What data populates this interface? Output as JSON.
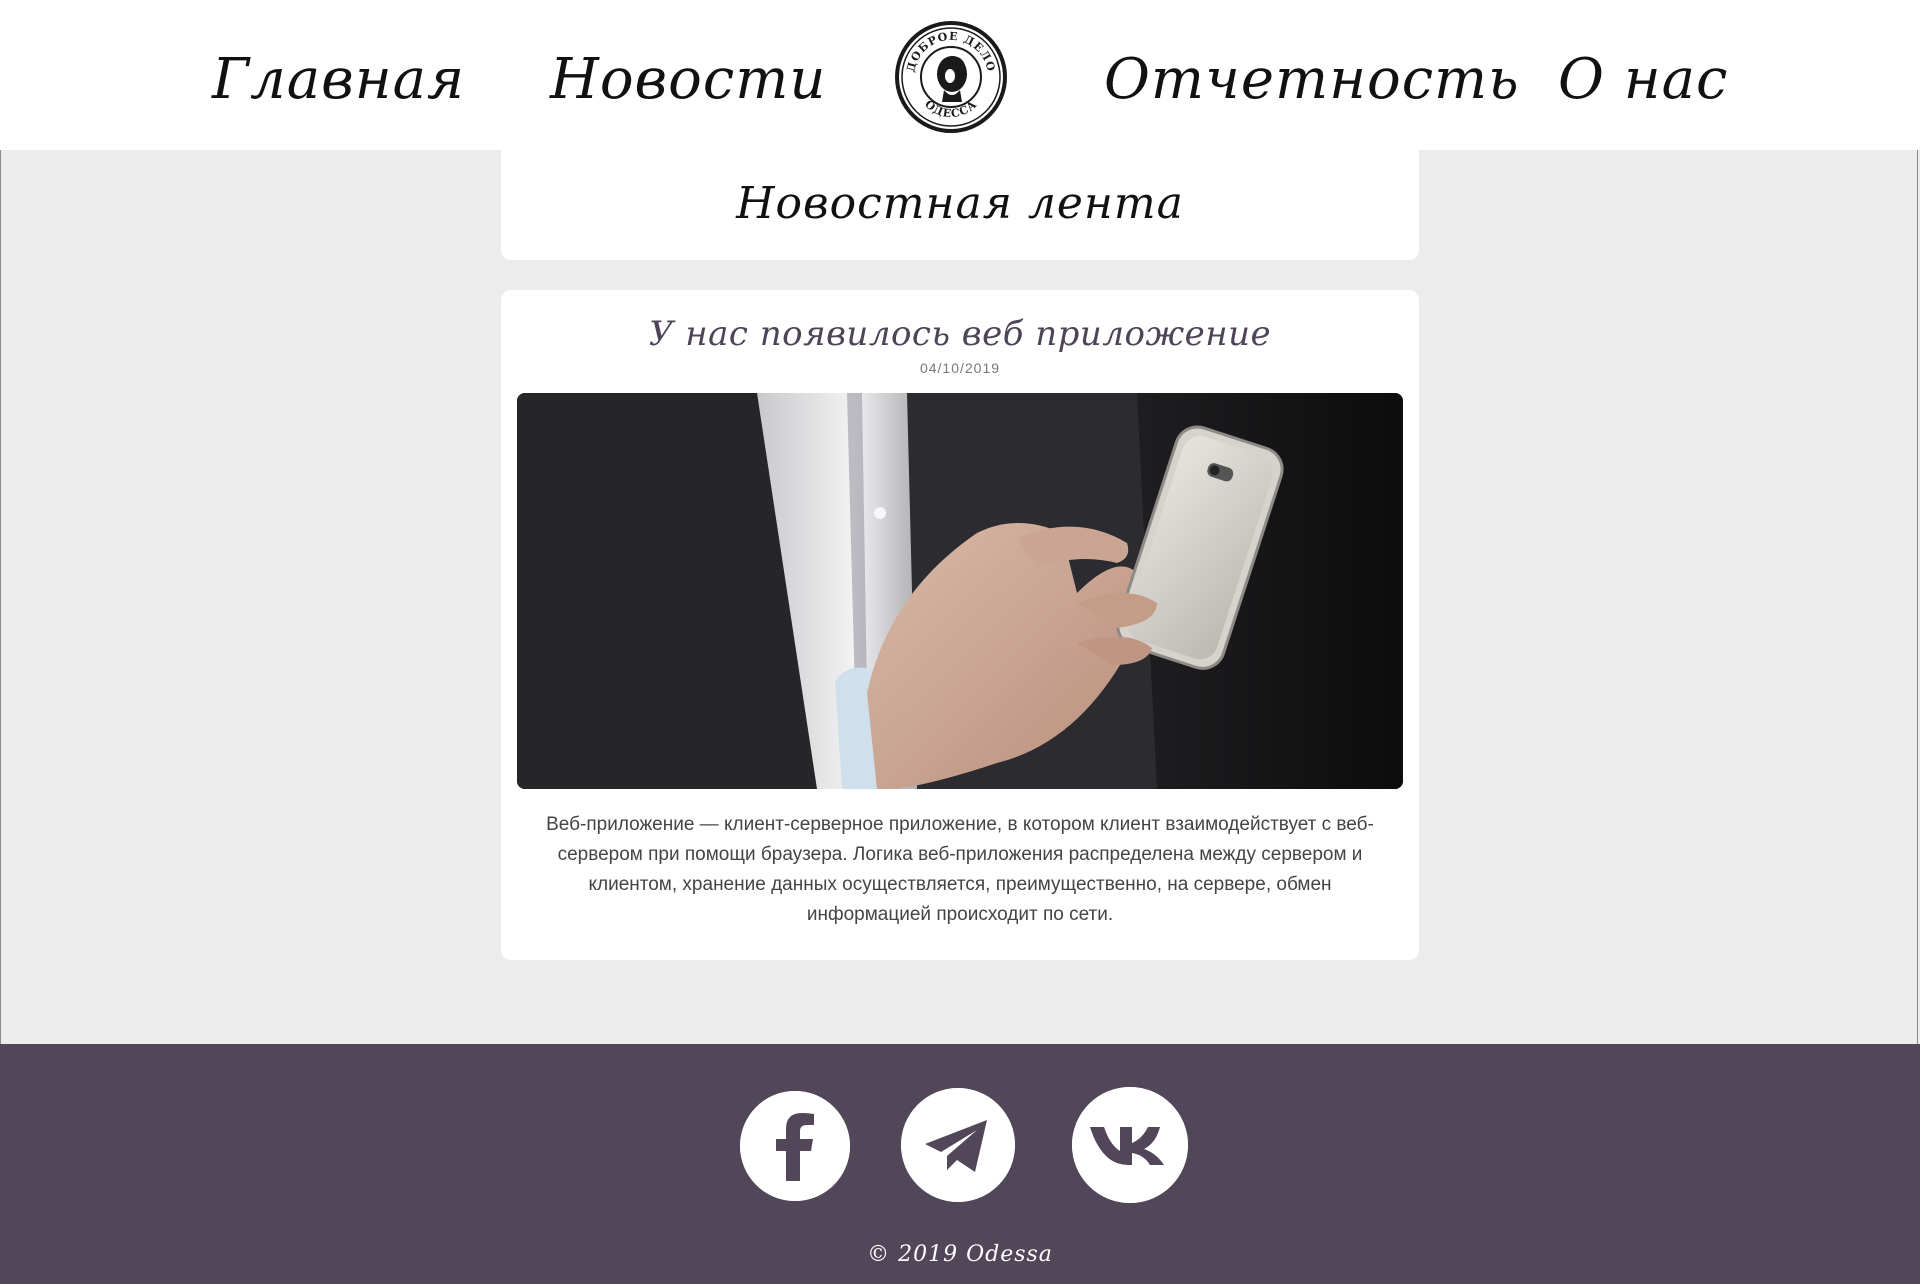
{
  "header": {
    "nav": {
      "home": "Главная",
      "news": "Новости",
      "reports": "Отчетность",
      "about": "О нас"
    },
    "logo": {
      "icon": "stamp-logo-icon",
      "top_text": "ДОБРОЕ ДЕЛО",
      "bottom_text": "ОДЕССА"
    }
  },
  "feed": {
    "title": "Новостная лента"
  },
  "post": {
    "title": "У нас появилось веб приложение",
    "date": "04/10/2019",
    "image_icon": "hand-holding-phone-photo",
    "text": "Веб-приложение — клиент-серверное приложение, в котором клиент взаимодействует с веб-сервером при помощи браузера. Логика веб-приложения распределена между сервером и клиентом, хранение данных осуществляется, преимущественно, на сервере, обмен информацией происходит по сети."
  },
  "footer": {
    "social": [
      {
        "name": "facebook",
        "icon": "facebook-icon"
      },
      {
        "name": "telegram",
        "icon": "telegram-icon"
      },
      {
        "name": "vk",
        "icon": "vk-icon"
      }
    ],
    "copyright": "© 2019 Odessa"
  },
  "colors": {
    "background": "#ececed",
    "footer": "#524659",
    "post_title": "#4e4458"
  }
}
